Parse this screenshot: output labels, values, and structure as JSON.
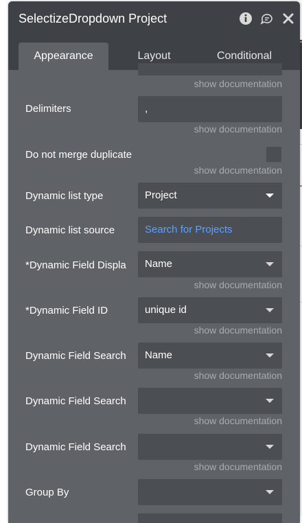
{
  "window": {
    "title": "SelectizeDropdown Project",
    "icons": [
      "info-icon",
      "chat-icon",
      "close-icon"
    ]
  },
  "tabs": [
    {
      "label": "Appearance",
      "active": true
    },
    {
      "label": "Layout",
      "active": false
    },
    {
      "label": "Conditional",
      "active": false
    }
  ],
  "doc_link": "show documentation",
  "fields": {
    "delimiters": {
      "label": "Delimiters",
      "value": ","
    },
    "no_merge": {
      "label": "Do not merge duplicate",
      "checked": false
    },
    "list_type": {
      "label": "Dynamic list type",
      "value": "Project"
    },
    "list_source": {
      "label": "Dynamic list source",
      "value": "Search for Projects"
    },
    "field_display": {
      "label": "*Dynamic Field Displa",
      "value": "Name"
    },
    "field_id": {
      "label": "*Dynamic Field ID",
      "value": "unique id"
    },
    "field_search_1": {
      "label": "Dynamic Field Search",
      "value": "Name"
    },
    "field_search_2": {
      "label": "Dynamic Field Search",
      "value": ""
    },
    "field_search_3": {
      "label": "Dynamic Field Search",
      "value": ""
    },
    "group_by": {
      "label": "Group By",
      "value": ""
    }
  },
  "colors": {
    "panel": "#5f6266",
    "header": "#3e4146",
    "input": "#4b4e52",
    "link": "#5ea1ff",
    "muted": "#a8abaf"
  }
}
